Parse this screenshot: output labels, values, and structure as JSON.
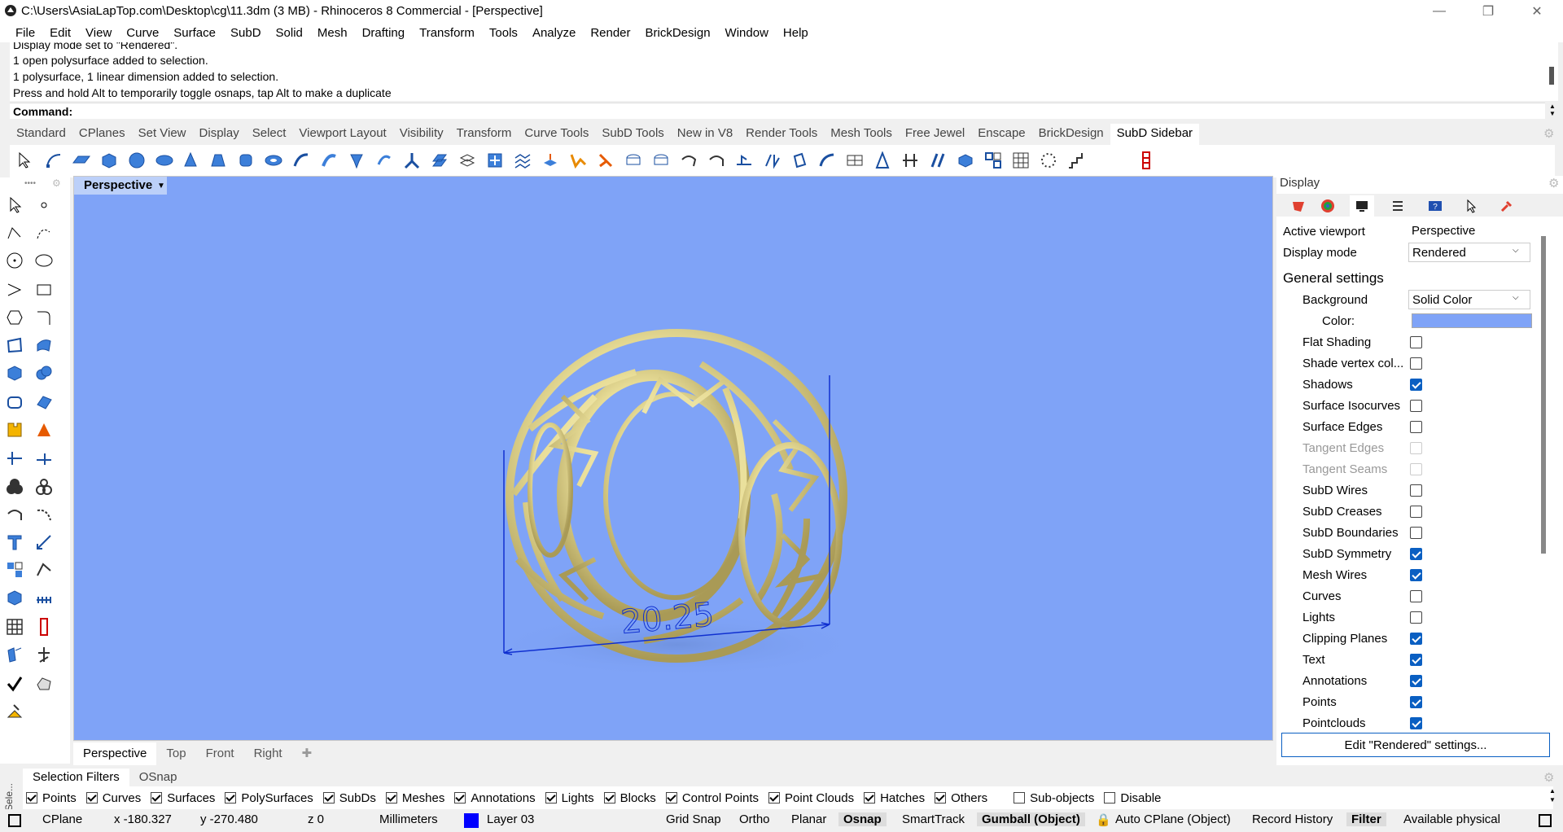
{
  "window": {
    "title": "C:\\Users\\AsiaLapTop.com\\Desktop\\cg\\11.3dm (3 MB) - Rhinoceros 8 Commercial - [Perspective]"
  },
  "menu": [
    "File",
    "Edit",
    "View",
    "Curve",
    "Surface",
    "SubD",
    "Solid",
    "Mesh",
    "Drafting",
    "Transform",
    "Tools",
    "Analyze",
    "Render",
    "BrickDesign",
    "Window",
    "Help"
  ],
  "command_history": [
    "Display mode set to \"Rendered\".",
    "1 open polysurface added to selection.",
    "1 polysurface, 1 linear dimension added to selection.",
    "Press and hold Alt to temporarily toggle osnaps, tap Alt to make a duplicate"
  ],
  "command": {
    "label": "Command:"
  },
  "toolbar_tabs": [
    "Standard",
    "CPlanes",
    "Set View",
    "Display",
    "Select",
    "Viewport Layout",
    "Visibility",
    "Transform",
    "Curve Tools",
    "SubD Tools",
    "New in V8",
    "Render Tools",
    "Mesh Tools",
    "Free Jewel",
    "Enscape",
    "BrickDesign",
    "SubD Sidebar"
  ],
  "toolbar_active_tab": "SubD Sidebar",
  "viewport": {
    "name": "Perspective",
    "dimension_text": "20.25",
    "background_color": "#7fa3f7"
  },
  "viewport_tabs": [
    "Perspective",
    "Top",
    "Front",
    "Right"
  ],
  "panel": {
    "title": "Display",
    "active_viewport_label": "Active viewport",
    "active_viewport_value": "Perspective",
    "display_mode_label": "Display mode",
    "display_mode_value": "Rendered",
    "general_settings": "General settings",
    "background_label": "Background",
    "background_value": "Solid Color",
    "color_label": "Color:",
    "color_value": "#7fa3f7",
    "options": [
      {
        "label": "Flat Shading",
        "checked": false,
        "disabled": false
      },
      {
        "label": "Shade vertex col...",
        "checked": false,
        "disabled": false
      },
      {
        "label": "Shadows",
        "checked": true,
        "disabled": false
      },
      {
        "label": "Surface Isocurves",
        "checked": false,
        "disabled": false
      },
      {
        "label": "Surface Edges",
        "checked": false,
        "disabled": false
      },
      {
        "label": "Tangent Edges",
        "checked": false,
        "disabled": true
      },
      {
        "label": "Tangent Seams",
        "checked": false,
        "disabled": true
      },
      {
        "label": "SubD Wires",
        "checked": false,
        "disabled": false
      },
      {
        "label": "SubD Creases",
        "checked": false,
        "disabled": false
      },
      {
        "label": "SubD Boundaries",
        "checked": false,
        "disabled": false
      },
      {
        "label": "SubD Symmetry",
        "checked": true,
        "disabled": false
      },
      {
        "label": "Mesh Wires",
        "checked": true,
        "disabled": false
      },
      {
        "label": "Curves",
        "checked": false,
        "disabled": false
      },
      {
        "label": "Lights",
        "checked": false,
        "disabled": false
      },
      {
        "label": "Clipping Planes",
        "checked": true,
        "disabled": false
      },
      {
        "label": "Text",
        "checked": true,
        "disabled": false
      },
      {
        "label": "Annotations",
        "checked": true,
        "disabled": false
      },
      {
        "label": "Points",
        "checked": true,
        "disabled": false
      },
      {
        "label": "Pointclouds",
        "checked": true,
        "disabled": false
      }
    ],
    "edit_button": "Edit \"Rendered\" settings..."
  },
  "selection_tabs": [
    "Selection Filters",
    "OSnap"
  ],
  "side_label": "Sele...",
  "filters": [
    {
      "label": "Points",
      "checked": true
    },
    {
      "label": "Curves",
      "checked": true
    },
    {
      "label": "Surfaces",
      "checked": true
    },
    {
      "label": "PolySurfaces",
      "checked": true
    },
    {
      "label": "SubDs",
      "checked": true
    },
    {
      "label": "Meshes",
      "checked": true
    },
    {
      "label": "Annotations",
      "checked": true
    },
    {
      "label": "Lights",
      "checked": true
    },
    {
      "label": "Blocks",
      "checked": true
    },
    {
      "label": "Control Points",
      "checked": true
    },
    {
      "label": "Point Clouds",
      "checked": true
    },
    {
      "label": "Hatches",
      "checked": true
    },
    {
      "label": "Others",
      "checked": true
    },
    {
      "label": "Sub-objects",
      "checked": false
    },
    {
      "label": "Disable",
      "checked": false
    }
  ],
  "status": {
    "cplane": "CPlane",
    "x": "x -180.327",
    "y": "y -270.480",
    "z": "z 0",
    "units": "Millimeters",
    "layer": "Layer 03",
    "layer_color": "#0000ff",
    "grid_snap": "Grid Snap",
    "ortho": "Ortho",
    "planar": "Planar",
    "osnap": "Osnap",
    "smarttrack": "SmartTrack",
    "gumball": "Gumball (Object)",
    "auto_cplane": "Auto CPlane (Object)",
    "record_history": "Record History",
    "filter": "Filter",
    "available": "Available physical"
  }
}
